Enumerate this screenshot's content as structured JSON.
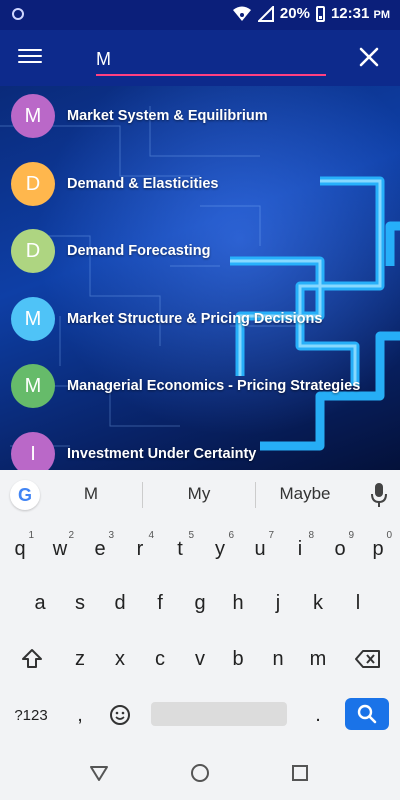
{
  "status_bar": {
    "battery_percent": "20%",
    "time": "12:31",
    "ampm": "PM"
  },
  "search": {
    "value": "M"
  },
  "results": [
    {
      "letter": "M",
      "label": "Market System & Equilibrium",
      "color": "#ba68c8"
    },
    {
      "letter": "D",
      "label": "Demand & Elasticities",
      "color": "#ffb74d"
    },
    {
      "letter": "D",
      "label": "Demand Forecasting",
      "color": "#aed581"
    },
    {
      "letter": "M",
      "label": "Market Structure & Pricing Decisions",
      "color": "#4fc3f7"
    },
    {
      "letter": "M",
      "label": "Managerial Economics - Pricing Strategies",
      "color": "#66bb6a"
    },
    {
      "letter": "I",
      "label": "Investment Under Certainty",
      "color": "#ba68c8"
    }
  ],
  "keyboard": {
    "suggestions": [
      "M",
      "My",
      "Maybe"
    ],
    "row1": [
      {
        "k": "q",
        "h": "1"
      },
      {
        "k": "w",
        "h": "2"
      },
      {
        "k": "e",
        "h": "3"
      },
      {
        "k": "r",
        "h": "4"
      },
      {
        "k": "t",
        "h": "5"
      },
      {
        "k": "y",
        "h": "6"
      },
      {
        "k": "u",
        "h": "7"
      },
      {
        "k": "i",
        "h": "8"
      },
      {
        "k": "o",
        "h": "9"
      },
      {
        "k": "p",
        "h": "0"
      }
    ],
    "row2": [
      "a",
      "s",
      "d",
      "f",
      "g",
      "h",
      "j",
      "k",
      "l"
    ],
    "row3": [
      "z",
      "x",
      "c",
      "v",
      "b",
      "n",
      "m"
    ],
    "symbols_label": "?123",
    "comma": ",",
    "period": "."
  },
  "icons": {
    "menu": "menu-icon",
    "close": "close-icon",
    "google": "google-logo-icon",
    "mic": "mic-icon",
    "shift": "shift-icon",
    "backspace": "backspace-icon",
    "emoji": "emoji-icon",
    "search": "search-icon",
    "back": "back-icon",
    "home": "home-icon",
    "recents": "recents-icon"
  },
  "colors": {
    "status_bar": "#0b1f7a",
    "app_bar": "#0d2a8c",
    "accent": "#ff4081",
    "search_key": "#1a73e8"
  }
}
